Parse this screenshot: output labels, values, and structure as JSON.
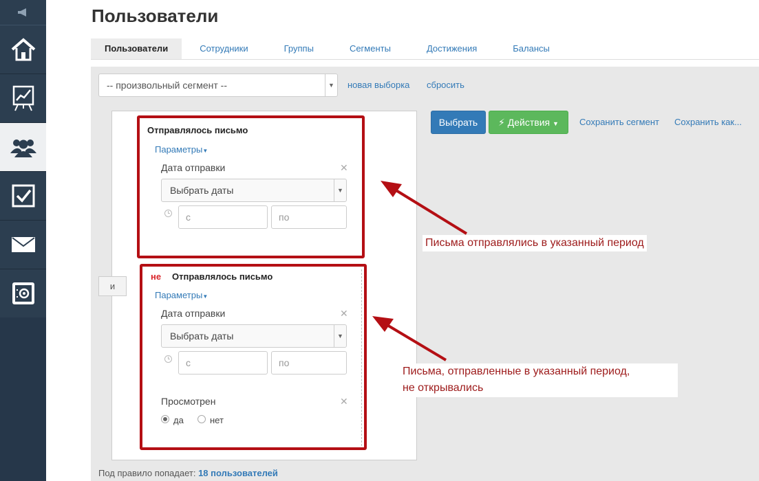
{
  "sidebar": {
    "items": [
      {
        "icon": "megaphone-icon"
      },
      {
        "icon": "home-icon"
      },
      {
        "icon": "chart-board-icon"
      },
      {
        "icon": "users-icon",
        "active": true
      },
      {
        "icon": "checkbox-icon"
      },
      {
        "icon": "envelope-icon"
      },
      {
        "icon": "safe-icon"
      }
    ]
  },
  "page": {
    "title": "Пользователи"
  },
  "tabs": [
    {
      "label": "Пользователи",
      "active": true
    },
    {
      "label": "Сотрудники"
    },
    {
      "label": "Группы"
    },
    {
      "label": "Сегменты"
    },
    {
      "label": "Достижения"
    },
    {
      "label": "Балансы"
    }
  ],
  "segment": {
    "selected": "-- произвольный сегмент --",
    "new_link": "новая выборка",
    "reset_link": "сбросить"
  },
  "actions": {
    "select_label": "Выбрать",
    "actions_label": "Действия",
    "save_segment": "Сохранить сегмент",
    "save_as": "Сохранить как..."
  },
  "rules": {
    "and_label": "и",
    "rule1": {
      "title": "Отправлялось письмо",
      "params": "Параметры",
      "field": "Дата отправки",
      "date_select": "Выбрать даты",
      "from_placeholder": "с",
      "to_placeholder": "по"
    },
    "rule2": {
      "negation": "не",
      "title": "Отправлялось письмо",
      "params": "Параметры",
      "field": "Дата отправки",
      "date_select": "Выбрать даты",
      "from_placeholder": "с",
      "to_placeholder": "по",
      "viewed_label": "Просмотрен",
      "yes": "да",
      "no": "нет",
      "viewed_value": "да"
    }
  },
  "annotations": {
    "note1": "Письма отправлялись в указанный период",
    "note2_line1": "Письма, отправленные в указанный период,",
    "note2_line2": "не открывались",
    "color": "#b40f14"
  },
  "footer": {
    "prefix": "Под правило попадает:",
    "count": "18 пользователей"
  }
}
